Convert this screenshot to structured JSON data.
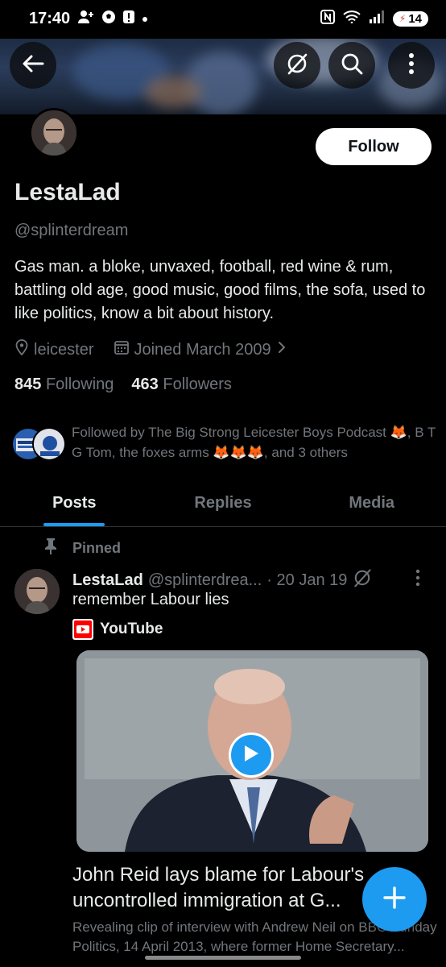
{
  "status_bar": {
    "time": "17:40",
    "battery": "14"
  },
  "profile": {
    "follow_label": "Follow",
    "display_name": "LestaLad",
    "handle": "@splinterdream",
    "bio": "Gas man. a bloke, unvaxed, football, red wine & rum, battling old age, good music, good films, the sofa, used to like politics, know a bit about history.",
    "location": "leicester",
    "joined": "Joined March 2009",
    "following_count": "845",
    "following_label": "Following",
    "followers_count": "463",
    "followers_label": "Followers",
    "followed_by": "Followed by The Big Strong Leicester Boys Podcast 🦊, B T G Tom, the foxes arms 🦊🦊🦊, and 3 others"
  },
  "tabs": [
    {
      "label": "Posts",
      "active": true
    },
    {
      "label": "Replies",
      "active": false
    },
    {
      "label": "Media",
      "active": false
    }
  ],
  "post": {
    "pinned_label": "Pinned",
    "author_name": "LestaLad",
    "author_handle": "@splinterdrea...",
    "date": "· 20 Jan 19",
    "text": "remember Labour lies",
    "source": "YouTube",
    "card_title": "John Reid lays blame for Labour's uncontrolled immigration at G...",
    "card_description": "Revealing clip of interview with Andrew Neil on BBC Sunday Politics, 14 April 2013, where former Home Secretary..."
  },
  "colors": {
    "accent": "#1d9bf0",
    "background": "#000000",
    "text_primary": "#e7e9ea",
    "text_secondary": "#71767b",
    "youtube_red": "#ff0000"
  },
  "icons": [
    "back-arrow-icon",
    "grok-icon",
    "search-icon",
    "more-vertical-icon",
    "location-pin-icon",
    "calendar-icon",
    "chevron-right-icon",
    "pin-icon",
    "youtube-icon",
    "play-icon",
    "plus-icon"
  ]
}
